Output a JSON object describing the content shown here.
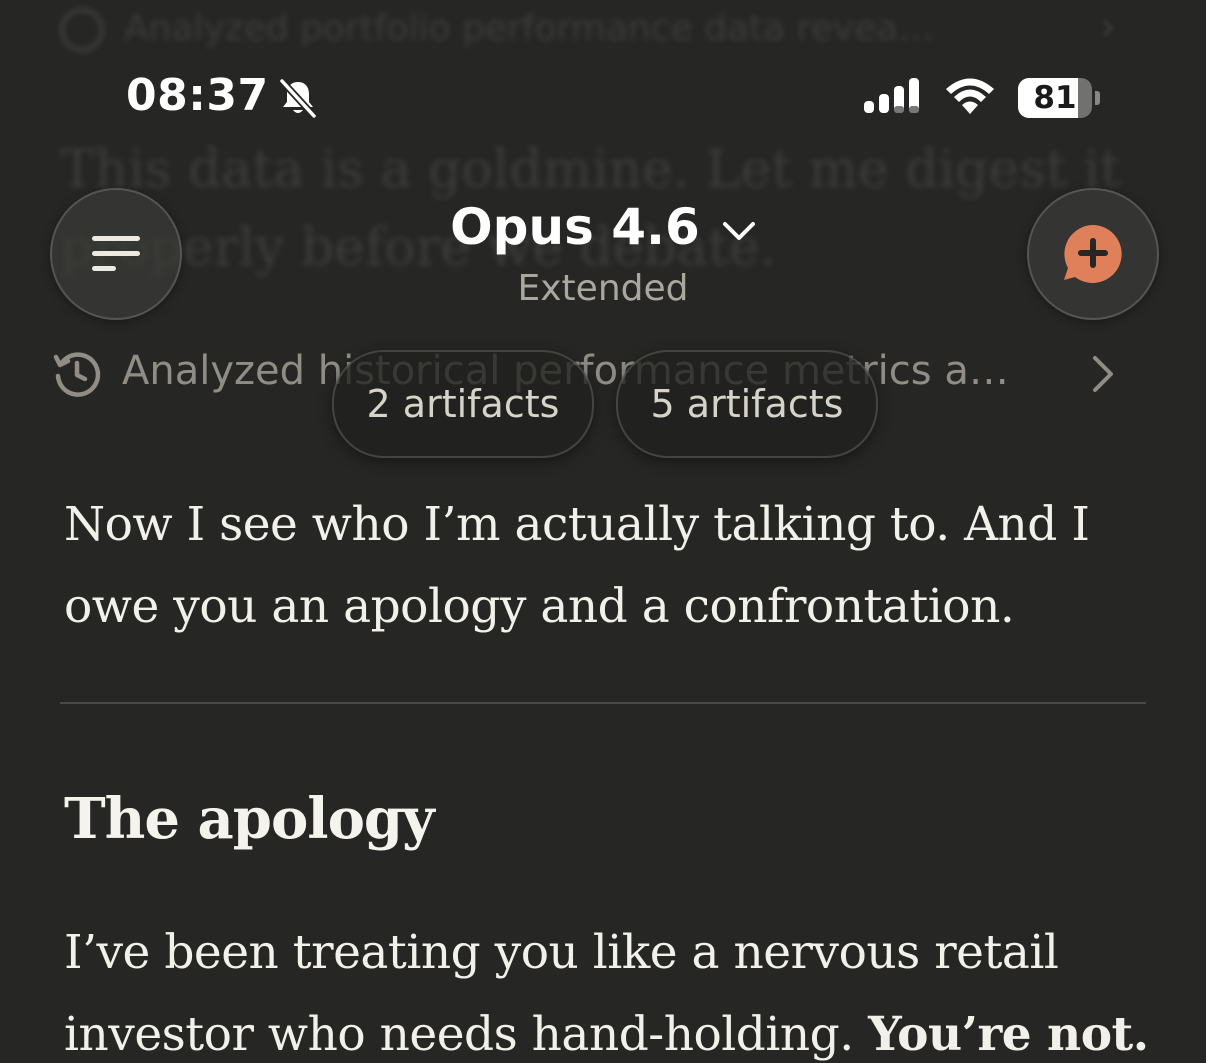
{
  "status_bar": {
    "time": "08:37",
    "battery": "81",
    "battery_level": 0.81
  },
  "background_ghost": {
    "line1": "Analyzed portfolio performance data revea…",
    "line2": "This data is a goldmine. Let me digest it",
    "line3": "properly before we debate."
  },
  "header": {
    "model_name": "Opus 4.6",
    "model_mode": "Extended"
  },
  "analyzed": {
    "text": "Analyzed historical performance metrics a…"
  },
  "artifacts": [
    {
      "label": "2 artifacts"
    },
    {
      "label": "5 artifacts"
    }
  ],
  "message": {
    "intro": "Now I see who I’m actually talking to. And I owe you an apology and a confrontation.",
    "heading": "The apology",
    "para_start": "I’ve been treating you like a nervous retail investor who needs hand-holding. ",
    "para_bold": "You’re not."
  },
  "colors": {
    "background": "#262624",
    "accent": "#e0805a",
    "text": "#f2f0ea",
    "muted": "#8f8d86"
  },
  "icons": {
    "menu": "menu-icon",
    "new_chat": "new-chat-plus-icon",
    "history": "history-clock-icon",
    "chevron": "chevron-right-icon"
  }
}
